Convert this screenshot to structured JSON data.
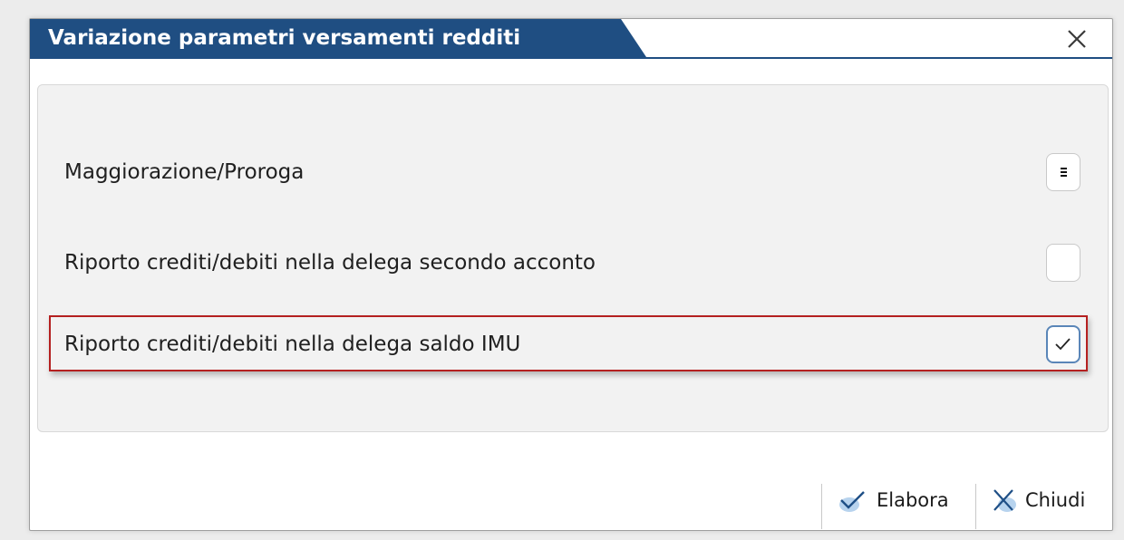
{
  "dialog": {
    "title": "Variazione parametri versamenti redditi"
  },
  "options": [
    {
      "label": "Maggiorazione/Proroga",
      "control": "menu",
      "checked": false
    },
    {
      "label": "Riporto crediti/debiti nella delega secondo acconto",
      "control": "checkbox",
      "checked": false
    },
    {
      "label": "Riporto crediti/debiti nella delega saldo IMU",
      "control": "checkbox",
      "checked": true
    }
  ],
  "footer": {
    "elabora_label": "Elabora",
    "chiudi_label": "Chiudi"
  },
  "colors": {
    "title_bar": "#1f4e82",
    "highlight": "#b52020",
    "check_border": "#5a86b8"
  }
}
